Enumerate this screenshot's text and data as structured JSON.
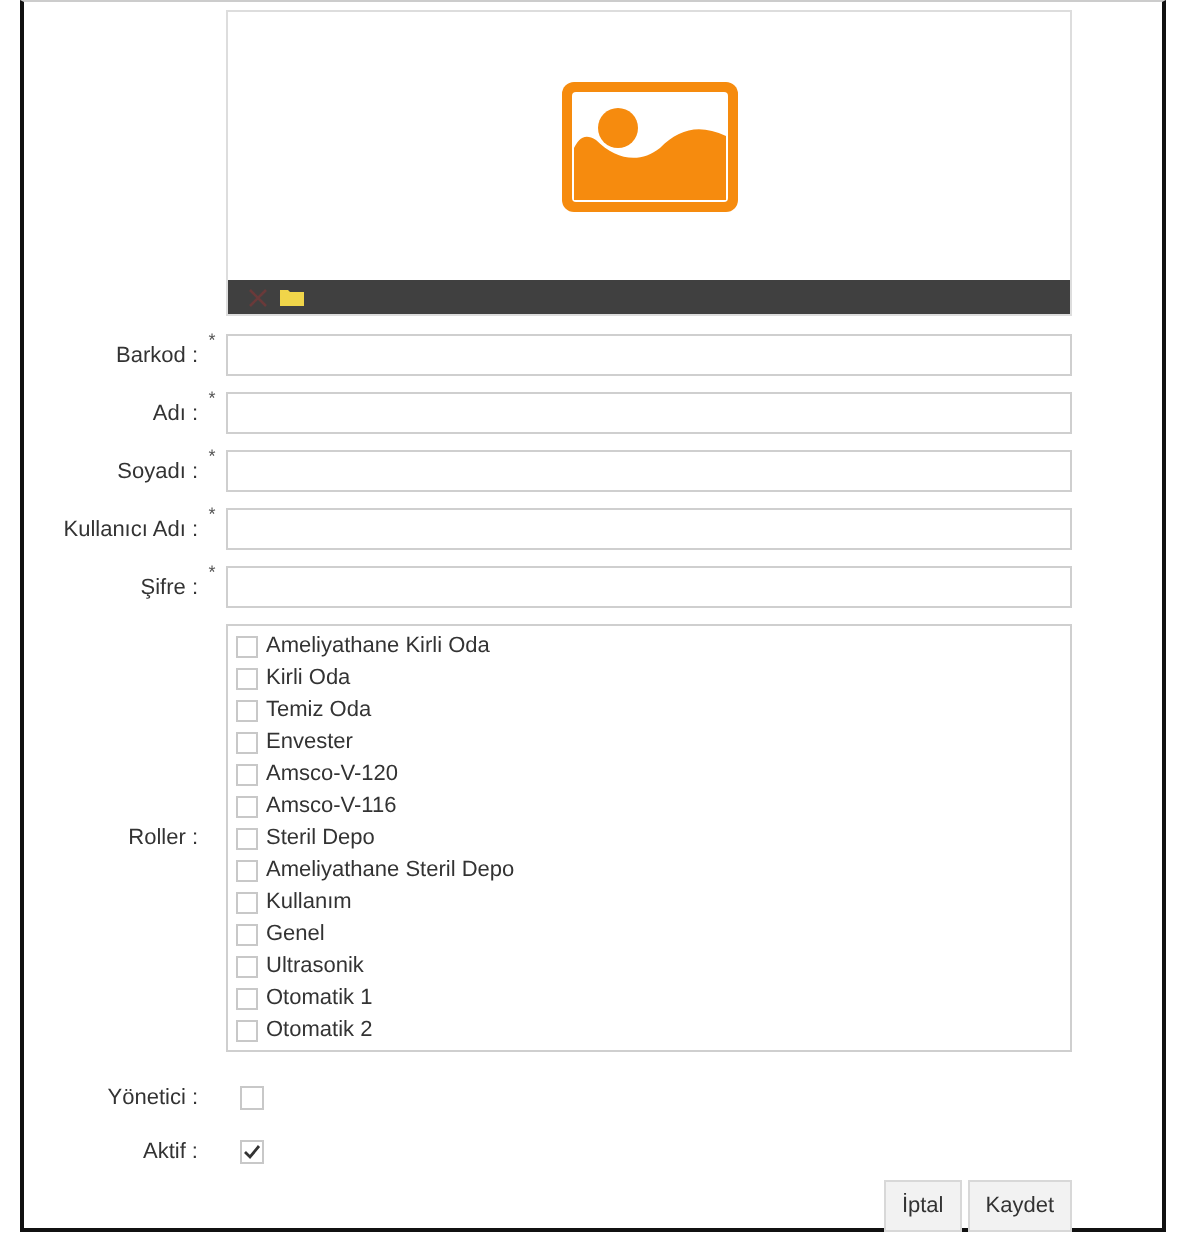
{
  "fields": [
    {
      "label": "Barkod :",
      "marker": "*"
    },
    {
      "label": "Adı :",
      "marker": "*"
    },
    {
      "label": "Soyadı :",
      "marker": "*"
    },
    {
      "label": "Kullanıcı Adı :",
      "marker": "*"
    },
    {
      "label": "Şifre :",
      "marker": "*"
    }
  ],
  "roles": {
    "label": "Roller :",
    "items": [
      {
        "label": "Ameliyathane Kirli Oda",
        "checked": false
      },
      {
        "label": "Kirli Oda",
        "checked": false
      },
      {
        "label": "Temiz Oda",
        "checked": false
      },
      {
        "label": "Envester",
        "checked": false
      },
      {
        "label": "Amsco-V-120",
        "checked": false
      },
      {
        "label": "Amsco-V-116",
        "checked": false
      },
      {
        "label": "Steril Depo",
        "checked": false
      },
      {
        "label": "Ameliyathane Steril Depo",
        "checked": false
      },
      {
        "label": "Kullanım",
        "checked": false
      },
      {
        "label": "Genel",
        "checked": false
      },
      {
        "label": "Ultrasonik",
        "checked": false
      },
      {
        "label": "Otomatik 1",
        "checked": false
      },
      {
        "label": "Otomatik 2",
        "checked": false
      }
    ]
  },
  "flags": [
    {
      "label": "Yönetici :",
      "checked": false
    },
    {
      "label": "Aktif :",
      "checked": true
    }
  ],
  "buttons": [
    "İptal",
    "Kaydet"
  ]
}
